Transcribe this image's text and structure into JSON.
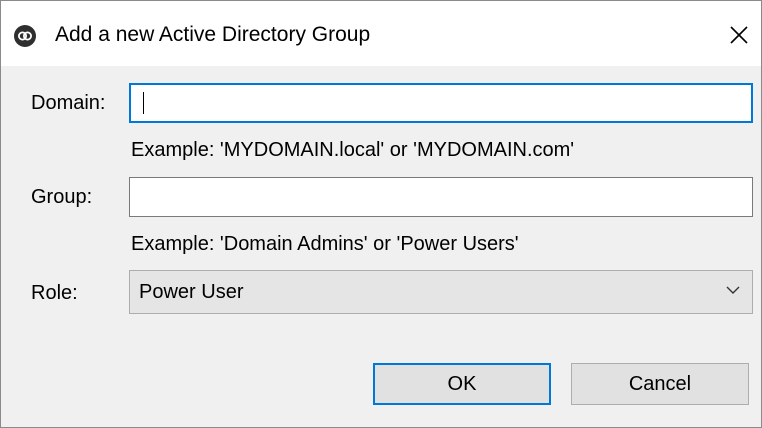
{
  "window": {
    "title": "Add a new Active Directory Group",
    "app_icon": "app-logo-icon",
    "close_icon": "close-icon"
  },
  "form": {
    "domain": {
      "label": "Domain:",
      "value": "",
      "hint": "Example:  'MYDOMAIN.local' or 'MYDOMAIN.com'"
    },
    "group": {
      "label": "Group:",
      "value": "",
      "hint": "Example:  'Domain Admins' or 'Power Users'"
    },
    "role": {
      "label": "Role:",
      "selected": "Power User",
      "dropdown_icon": "chevron-down-icon"
    }
  },
  "buttons": {
    "ok_label": "OK",
    "cancel_label": "Cancel"
  },
  "colors": {
    "accent": "#0078d7",
    "background": "#f0f0f0",
    "titlebar": "#ffffff"
  }
}
